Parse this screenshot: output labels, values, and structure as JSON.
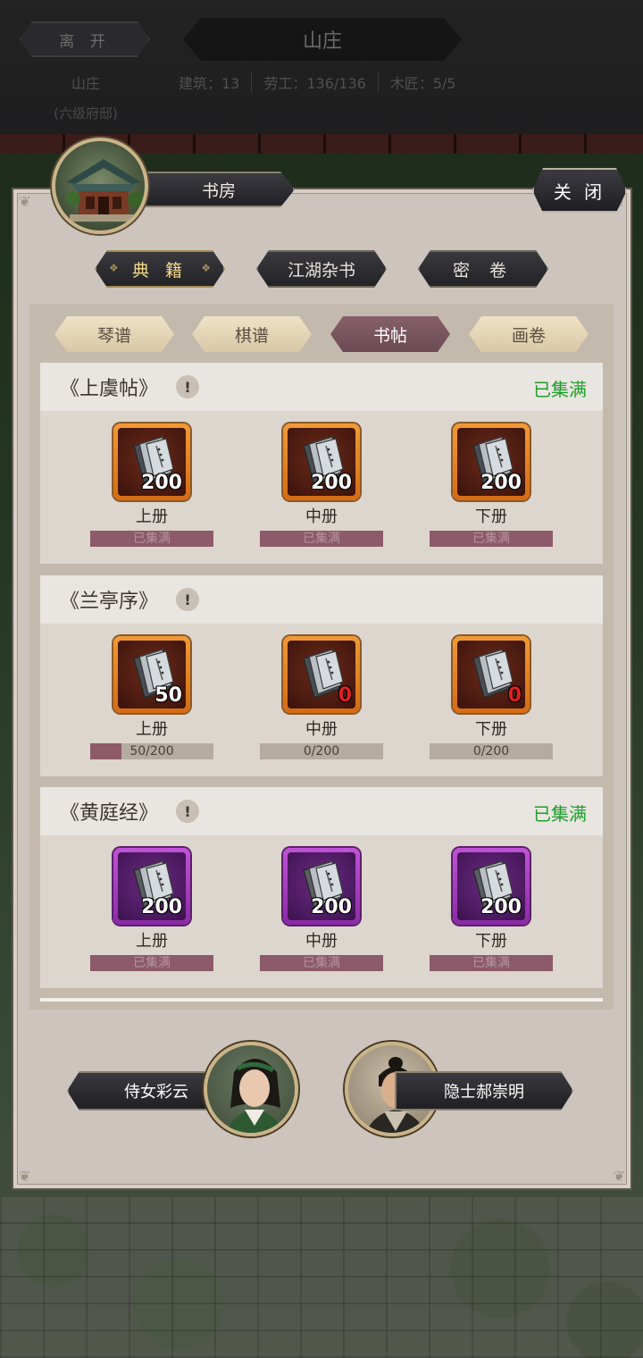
{
  "topbar": {
    "leave_label": "离 开",
    "title": "山庄",
    "estate_name": "山庄",
    "estate_level": "(六级府邸)",
    "stats": [
      "建筑：13",
      "劳工：136/136",
      "木匠：5/5"
    ]
  },
  "panel": {
    "title": "书房",
    "close_label": "关 闭",
    "categories": [
      "典 籍",
      "江湖杂书",
      "密 卷"
    ],
    "active_category": "典 籍",
    "sub_tabs": [
      "琴谱",
      "棋谱",
      "书帖",
      "画卷"
    ],
    "active_sub_tab": "书帖"
  },
  "collections": [
    {
      "name": "《上虞帖》",
      "status": "已集满",
      "quality": "orange",
      "volumes": [
        {
          "name": "上册",
          "count": "200",
          "progress_text": "已集满",
          "progress_fraction": 1
        },
        {
          "name": "中册",
          "count": "200",
          "progress_text": "已集满",
          "progress_fraction": 1
        },
        {
          "name": "下册",
          "count": "200",
          "progress_text": "已集满",
          "progress_fraction": 1
        }
      ]
    },
    {
      "name": "《兰亭序》",
      "status": "",
      "quality": "orange",
      "volumes": [
        {
          "name": "上册",
          "count": "50",
          "progress_text": "50/200",
          "progress_fraction": 0.25
        },
        {
          "name": "中册",
          "count": "0",
          "progress_text": "0/200",
          "progress_fraction": 0
        },
        {
          "name": "下册",
          "count": "0",
          "progress_text": "0/200",
          "progress_fraction": 0
        }
      ]
    },
    {
      "name": "《黄庭经》",
      "status": "已集满",
      "quality": "purple",
      "volumes": [
        {
          "name": "上册",
          "count": "200",
          "progress_text": "已集满",
          "progress_fraction": 1
        },
        {
          "name": "中册",
          "count": "200",
          "progress_text": "已集满",
          "progress_fraction": 1
        },
        {
          "name": "下册",
          "count": "200",
          "progress_text": "已集满",
          "progress_fraction": 1
        }
      ]
    }
  ],
  "npcs": [
    {
      "name": "侍女彩云"
    },
    {
      "name": "隐士郝崇明"
    }
  ],
  "colors": {
    "status_full": "#1f9e2c",
    "progress_fill": "#8c5a69",
    "zero_count": "#e02020",
    "active_sub_tab": "#7a5560"
  },
  "icons": {
    "info": "info-icon",
    "book": "scroll-book-icon",
    "building": "study-building-icon"
  }
}
